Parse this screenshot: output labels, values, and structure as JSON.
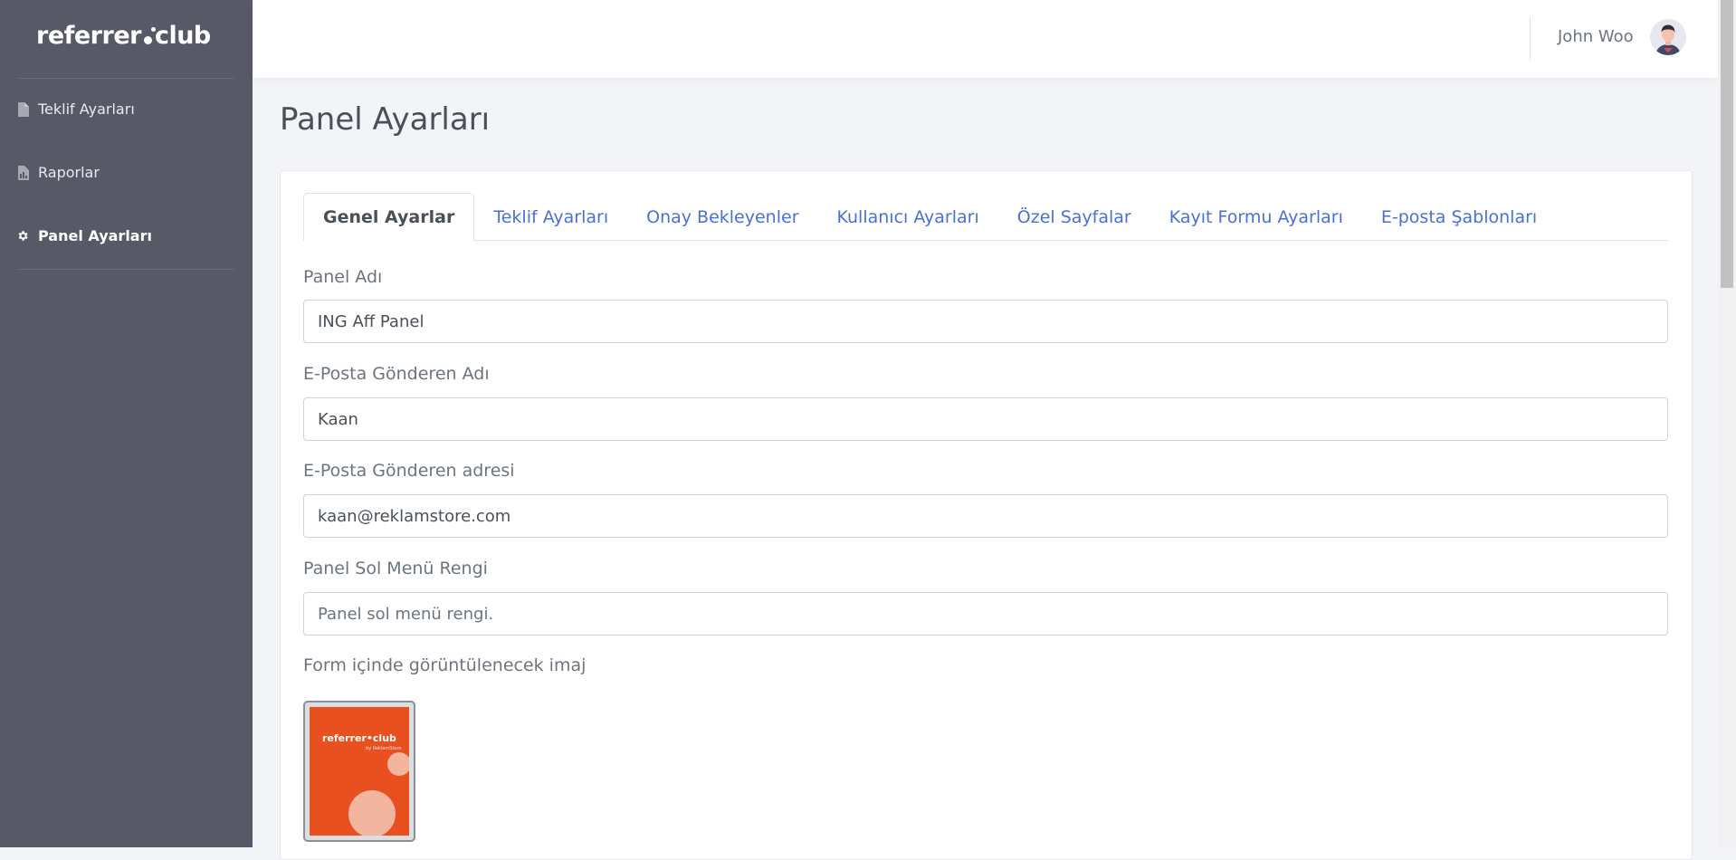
{
  "brand": {
    "logo_left": "referrer",
    "logo_right": "club"
  },
  "sidebar": {
    "items": [
      {
        "label": "Teklif Ayarları",
        "icon": "file-icon"
      },
      {
        "label": "Raporlar",
        "icon": "file-chart-icon"
      },
      {
        "label": "Panel Ayarları",
        "icon": "gear-icon",
        "active": true
      }
    ]
  },
  "header": {
    "user_name": "John Woo"
  },
  "page": {
    "title": "Panel Ayarları"
  },
  "tabs": [
    {
      "label": "Genel Ayarlar",
      "active": true
    },
    {
      "label": "Teklif Ayarları"
    },
    {
      "label": "Onay Bekleyenler"
    },
    {
      "label": "Kullanıcı Ayarları"
    },
    {
      "label": "Özel Sayfalar"
    },
    {
      "label": "Kayıt Formu Ayarları"
    },
    {
      "label": "E-posta Şablonları"
    }
  ],
  "form": {
    "panel_name": {
      "label": "Panel Adı",
      "value": "ING Aff Panel"
    },
    "sender_name": {
      "label": "E-Posta Gönderen Adı",
      "value": "Kaan"
    },
    "sender_address": {
      "label": "E-Posta Gönderen adresi",
      "value": "kaan@reklamstore.com"
    },
    "menu_color": {
      "label": "Panel Sol Menü Rengi",
      "value": "",
      "placeholder": "Panel sol menü rengi."
    },
    "form_image": {
      "label": "Form içinde görüntülenecek imaj",
      "logo_left": "referrer",
      "logo_right": "club",
      "subtitle": "by ReklamStore"
    }
  },
  "colors": {
    "sidebar_bg": "#575966",
    "accent_link": "#4a6fd8",
    "image_bg": "#e8501f"
  }
}
